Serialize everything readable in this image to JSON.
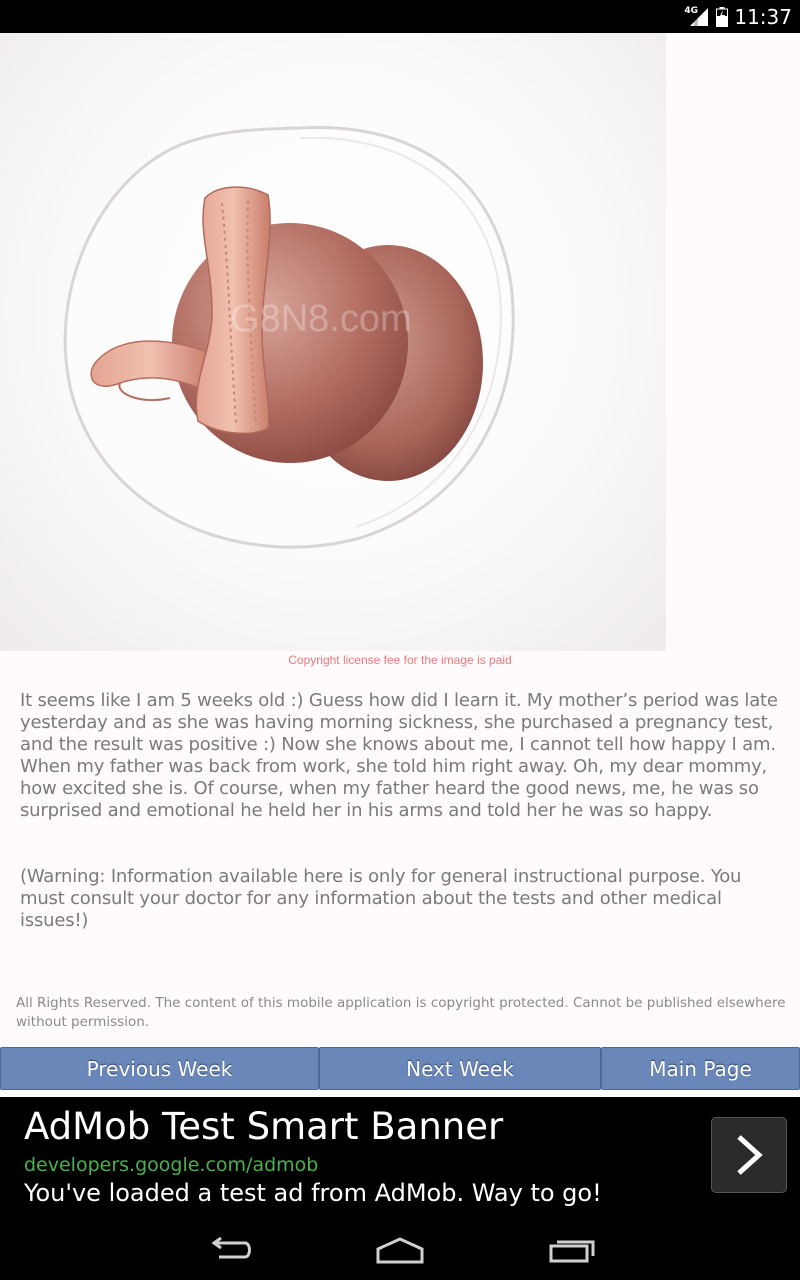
{
  "status_bar": {
    "network": "4G",
    "time": "11:37"
  },
  "hero": {
    "watermark": "G8N8.com",
    "caption": "Copyright license fee for the image is paid"
  },
  "content": {
    "paragraph": "It seems like I am 5 weeks old :) Guess how did I learn it. My mother’s period was late yesterday and as she was having morning sickness, she purchased a pregnancy test, and the result was positive :) Now she knows about me, I cannot tell how happy I am. When my father was back from work, she told him right away. Oh, my dear mommy, how excited she is. Of course, when my father heard the good news, me, he was so surprised and emotional he held her in his arms and told her he was so happy.",
    "warning": "(Warning: Information available here is only for general instructional purpose. You must consult your doctor for any information about the tests and other medical issues!)",
    "rights": "All Rights Reserved. The content of this mobile application is copyright protected. Cannot be published elsewhere without permission."
  },
  "nav_buttons": {
    "previous": "Previous Week",
    "next": "Next Week",
    "main": "Main Page"
  },
  "ad": {
    "title": "AdMob Test Smart Banner",
    "url": "developers.google.com/admob",
    "description": "You've loaded a test ad from AdMob. Way to go!"
  },
  "colors": {
    "button": "#6a87b9",
    "caption": "#e87a7a",
    "ad_url": "#4caf50"
  }
}
